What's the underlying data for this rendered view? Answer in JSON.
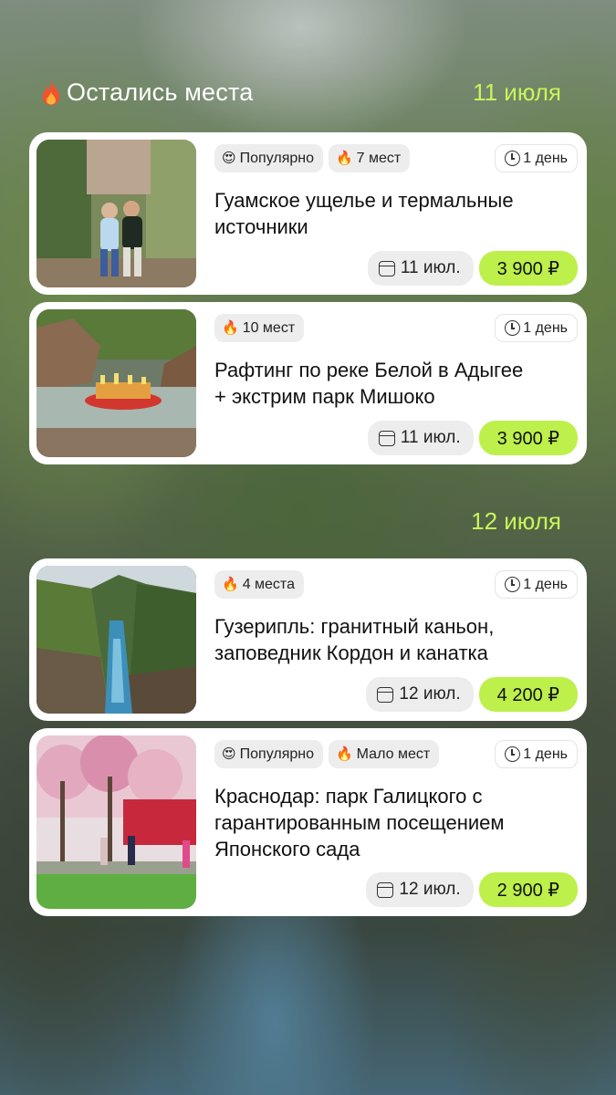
{
  "sections": [
    {
      "title": "Остались места",
      "date": "11 июля",
      "show_icon": true
    },
    {
      "title": "",
      "date": "12 июля",
      "show_icon": false
    }
  ],
  "cards": [
    {
      "badges": [
        {
          "emoji": "😍",
          "text": "Популярно"
        },
        {
          "emoji": "🔥",
          "text": "7 мест"
        }
      ],
      "duration": "1 день",
      "title_lines": [
        "Гуамское ущелье и термальные",
        "источники"
      ],
      "date": "11 июл.",
      "price": "3 900 ₽",
      "photo": "two women posing in gorge"
    },
    {
      "badges": [
        {
          "emoji": "🔥",
          "text": "10 мест"
        }
      ],
      "duration": "1 день",
      "title_lines": [
        "Рафтинг по реке Белой в Адыгее",
        "+ экстрим парк Мишоко"
      ],
      "date": "11 июл.",
      "price": "3 900 ₽",
      "photo": "rafting boat on river"
    },
    {
      "badges": [
        {
          "emoji": "🔥",
          "text": "4 места"
        }
      ],
      "duration": "1 день",
      "title_lines": [
        "Гузерипль: гранитный каньон,",
        "заповедник Кордон и канатка"
      ],
      "date": "12 июл.",
      "price": "4 200 ₽",
      "photo": "river in granite canyon"
    },
    {
      "badges": [
        {
          "emoji": "😍",
          "text": "Популярно"
        },
        {
          "emoji": "🔥",
          "text": "Мало мест"
        }
      ],
      "duration": "1 день",
      "title_lines": [
        "Краснодар: парк Галицкого с",
        "гарантированным посещением",
        "Японского сада"
      ],
      "date": "12 июл.",
      "price": "2 900 ₽",
      "photo": "blossoming sakura park"
    }
  ],
  "colors": {
    "accent_green": "#bdf04a",
    "date_header": "#c9f55b"
  }
}
